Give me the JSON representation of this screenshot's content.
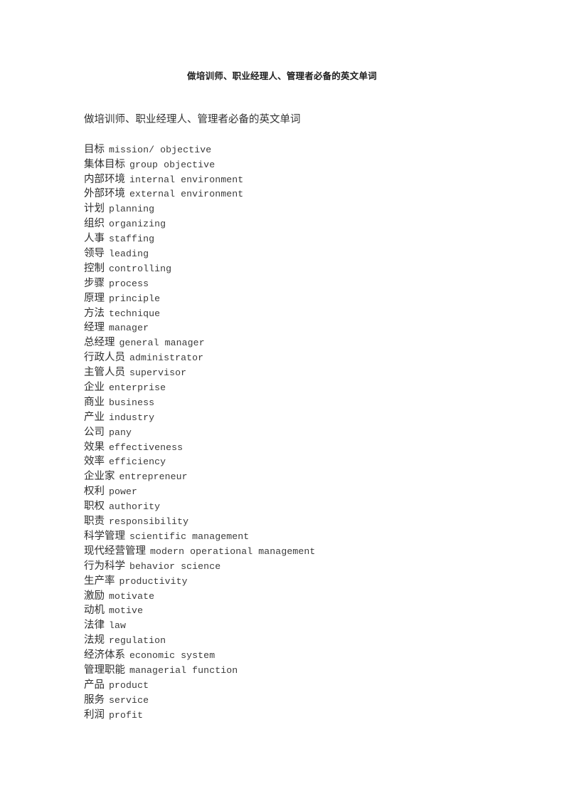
{
  "document": {
    "title": "做培训师、职业经理人、管理者必备的英文单词",
    "body_heading": "做培训师、职业经理人、管理者必备的英文单词",
    "entries": [
      {
        "cn": "目标",
        "en": "mission/ objective"
      },
      {
        "cn": "集体目标",
        "en": "group objective"
      },
      {
        "cn": "内部环境",
        "en": "internal environment"
      },
      {
        "cn": "外部环境",
        "en": "external environment"
      },
      {
        "cn": "计划",
        "en": "planning"
      },
      {
        "cn": "组织",
        "en": "organizing"
      },
      {
        "cn": "人事",
        "en": "staffing"
      },
      {
        "cn": "领导",
        "en": "leading"
      },
      {
        "cn": "控制",
        "en": "controlling"
      },
      {
        "cn": "步骤",
        "en": "process"
      },
      {
        "cn": "原理",
        "en": "principle"
      },
      {
        "cn": "方法",
        "en": "technique"
      },
      {
        "cn": "经理",
        "en": "manager"
      },
      {
        "cn": "总经理",
        "en": "general manager"
      },
      {
        "cn": "行政人员",
        "en": "administrator"
      },
      {
        "cn": "主管人员",
        "en": "supervisor"
      },
      {
        "cn": "企业",
        "en": "enterprise"
      },
      {
        "cn": "商业",
        "en": "business"
      },
      {
        "cn": "产业",
        "en": "industry"
      },
      {
        "cn": "公司",
        "en": "pany"
      },
      {
        "cn": "效果",
        "en": "effectiveness"
      },
      {
        "cn": "效率",
        "en": "efficiency"
      },
      {
        "cn": "企业家",
        "en": "entrepreneur"
      },
      {
        "cn": "权利",
        "en": "power"
      },
      {
        "cn": "职权",
        "en": "authority"
      },
      {
        "cn": "职责",
        "en": "responsibility"
      },
      {
        "cn": "科学管理",
        "en": "scientific management"
      },
      {
        "cn": "现代经营管理",
        "en": "modern operational management"
      },
      {
        "cn": "行为科学",
        "en": "behavior science"
      },
      {
        "cn": "生产率",
        "en": "productivity"
      },
      {
        "cn": "激励",
        "en": "motivate"
      },
      {
        "cn": "动机",
        "en": "motive"
      },
      {
        "cn": "法律",
        "en": "law"
      },
      {
        "cn": "法规",
        "en": "regulation"
      },
      {
        "cn": "经济体系",
        "en": "economic system"
      },
      {
        "cn": "管理职能",
        "en": "managerial function"
      },
      {
        "cn": "产品",
        "en": "product"
      },
      {
        "cn": "服务",
        "en": "service"
      },
      {
        "cn": "利润",
        "en": "profit"
      }
    ]
  }
}
